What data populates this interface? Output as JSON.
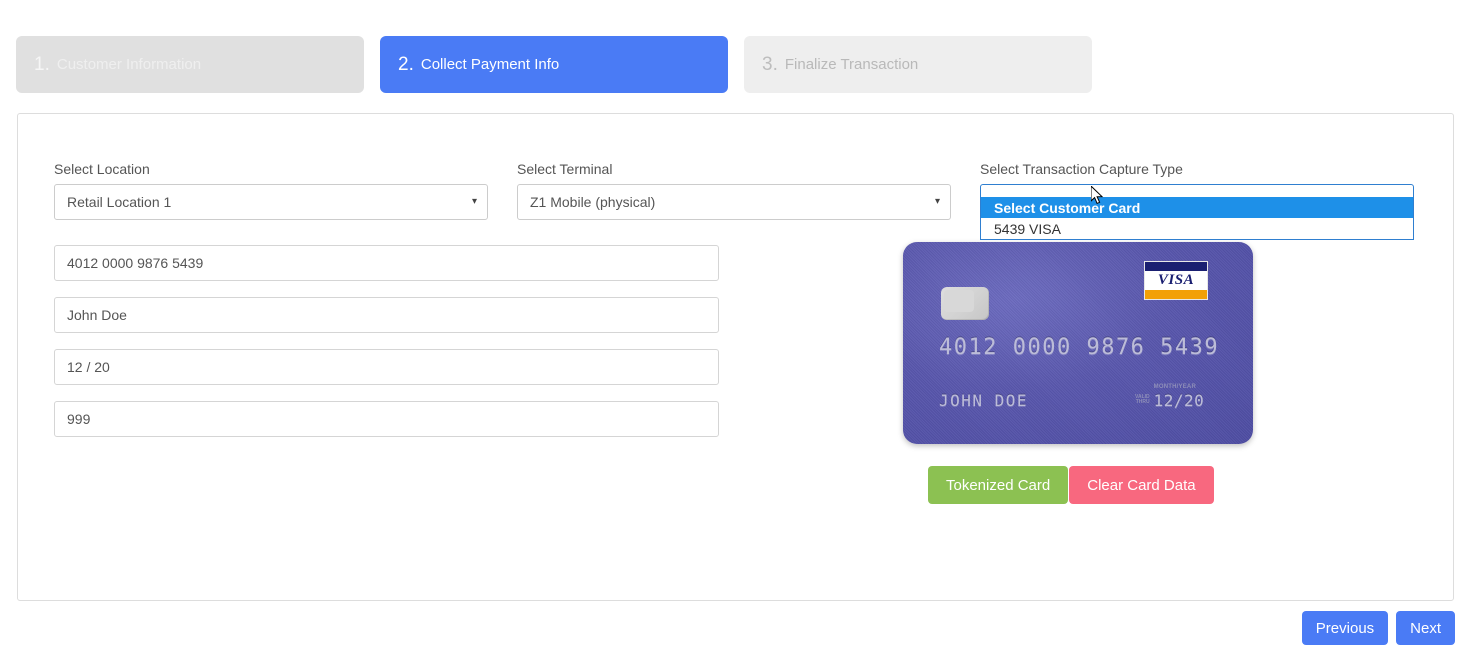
{
  "stepper": {
    "steps": [
      {
        "num": "1.",
        "label": "Customer Information",
        "state": "inactive"
      },
      {
        "num": "2.",
        "label": "Collect Payment Info",
        "state": "active"
      },
      {
        "num": "3.",
        "label": "Finalize Transaction",
        "state": "inactive"
      }
    ]
  },
  "form": {
    "location": {
      "label": "Select Location",
      "value": "Retail Location 1",
      "caret": "▾"
    },
    "terminal": {
      "label": "Select Terminal",
      "value": "Z1 Mobile (physical)",
      "caret": "▾"
    },
    "capture_type": {
      "label": "Select Transaction Capture Type",
      "value": "Select Customer Card",
      "caret": "▾",
      "open": true,
      "options": [
        {
          "label": "Select Customer Card",
          "selected": true
        },
        {
          "label": "5439 VISA",
          "selected": false
        }
      ]
    },
    "inputs": {
      "card_number": "4012 0000 9876 5439",
      "card_name": "John Doe",
      "card_expiry": "12 / 20",
      "card_cvv": "999"
    }
  },
  "credit_card": {
    "number": "4012 0000 9876 5439",
    "name": "JOHN DOE",
    "valid_thru_line1": "valid",
    "valid_thru_line2": "thru",
    "month_year_label": "MONTH/YEAR",
    "expiry": "12/20",
    "brand": "VISA",
    "brand_colors": {
      "navy": "#1a1f71",
      "orange": "#f2a007"
    },
    "card_color": "#5957ad"
  },
  "card_actions": {
    "tokenize_label": "Tokenized Card",
    "clear_label": "Clear Card Data",
    "tokenize_color": "#8cc152",
    "clear_color": "#f8687f"
  },
  "footer": {
    "previous_label": "Previous",
    "next_label": "Next",
    "accent_color": "#4a7bf5"
  },
  "cursor": {
    "icon": "mouse-pointer-icon"
  }
}
